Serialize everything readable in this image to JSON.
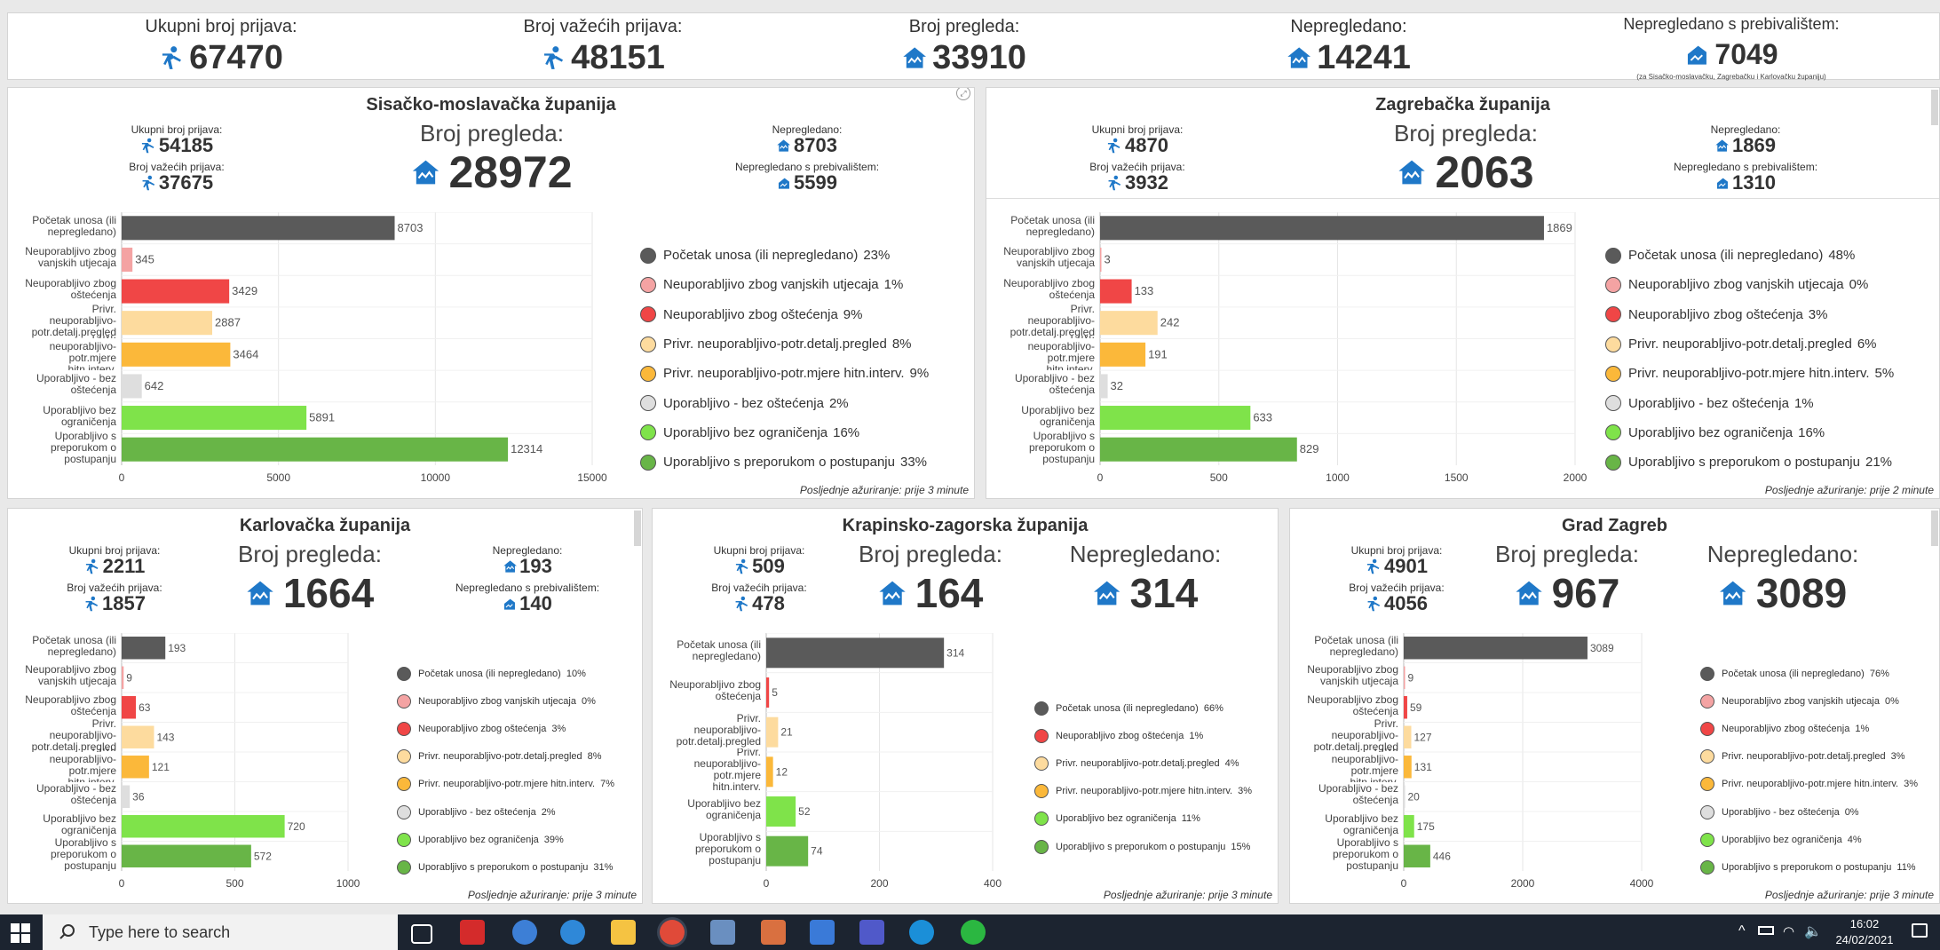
{
  "summary": [
    {
      "label": "Ukupni broj prijava:",
      "value": "67470",
      "icon": "person-icon"
    },
    {
      "label": "Broj važećih prijava:",
      "value": "48151",
      "icon": "person-icon"
    },
    {
      "label": "Broj pregleda:",
      "value": "33910",
      "icon": "house-icon"
    },
    {
      "label": "Nepregledano:",
      "value": "14241",
      "icon": "house-icon"
    },
    {
      "label": "Nepregledano s prebivalištem:",
      "value": "7049",
      "icon": "house-small-icon",
      "note": "(za Sisačko-moslavačku, Zagrebačku i Karlovačku županiju)"
    }
  ],
  "categories": [
    "Početak unosa (ili nepregledano)",
    "Neuporabljivo zbog vanjskih utjecaja",
    "Neuporabljivo zbog oštećenja",
    "Privr. neuporabljivo-potr.detalj.pregled",
    "Privr. neuporabljivo-potr.mjere hitn.interv.",
    "Uporabljivo - bez oštećenja",
    "Uporabljivo bez ograničenja",
    "Uporabljivo s preporukom o postupanju"
  ],
  "colors": {
    "Početak unosa (ili nepregledano)": "#5a5a5a",
    "Neuporabljivo zbog vanjskih utjecaja": "#f4a3a3",
    "Neuporabljivo zbog oštećenja": "#f04646",
    "Privr. neuporabljivo-potr.detalj.pregled": "#fddb9e",
    "Privr. neuporabljivo-potr.mjere hitn.interv.": "#fbb83a",
    "Uporabljivo - bez oštećenja": "#dedede",
    "Uporabljivo bez ograničenja": "#7fe34a",
    "Uporabljivo s preporukom o postupanju": "#68b547"
  },
  "labels": {
    "ukupni": "Ukupni broj prijava:",
    "vazecih": "Broj važećih prijava:",
    "pregleda": "Broj pregleda:",
    "nepregledano": "Nepregledano:",
    "prebivaliste": "Nepregledano s prebivalištem:"
  },
  "panels": [
    {
      "title": "Sisačko-moslavačka županija",
      "ukupni": "54185",
      "vazecih": "37675",
      "pregleda": "28972",
      "nepregledano": "8703",
      "prebivaliste": "5599",
      "footer": "Posljednje ažuriranje: prije 3 minute",
      "chart_data": {
        "type": "bar",
        "values": [
          8703,
          345,
          3429,
          2887,
          3464,
          642,
          5891,
          12314
        ],
        "xlim": [
          0,
          15000
        ],
        "ticks": [
          0,
          5000,
          10000,
          15000
        ]
      },
      "legend": [
        {
          "name": "Početak unosa (ili nepregledano)",
          "pct": "23%"
        },
        {
          "name": "Neuporabljivo zbog vanjskih utjecaja",
          "pct": "1%"
        },
        {
          "name": "Neuporabljivo zbog oštećenja",
          "pct": "9%"
        },
        {
          "name": "Privr. neuporabljivo-potr.detalj.pregled",
          "pct": "8%"
        },
        {
          "name": "Privr. neuporabljivo-potr.mjere hitn.interv.",
          "pct": "9%"
        },
        {
          "name": "Uporabljivo - bez oštećenja",
          "pct": "2%"
        },
        {
          "name": "Uporabljivo bez ograničenja",
          "pct": "16%"
        },
        {
          "name": "Uporabljivo s preporukom o postupanju",
          "pct": "33%"
        }
      ]
    },
    {
      "title": "Zagrebačka županija",
      "ukupni": "4870",
      "vazecih": "3932",
      "pregleda": "2063",
      "nepregledano": "1869",
      "prebivaliste": "1310",
      "footer": "Posljednje ažuriranje: prije 2 minute",
      "chart_data": {
        "type": "bar",
        "values": [
          1869,
          3,
          133,
          242,
          191,
          32,
          633,
          829
        ],
        "xlim": [
          0,
          2000
        ],
        "ticks": [
          0,
          500,
          1000,
          1500,
          2000
        ]
      },
      "legend": [
        {
          "name": "Početak unosa (ili nepregledano)",
          "pct": "48%"
        },
        {
          "name": "Neuporabljivo zbog vanjskih utjecaja",
          "pct": "0%"
        },
        {
          "name": "Neuporabljivo zbog oštećenja",
          "pct": "3%"
        },
        {
          "name": "Privr. neuporabljivo-potr.detalj.pregled",
          "pct": "6%"
        },
        {
          "name": "Privr. neuporabljivo-potr.mjere hitn.interv.",
          "pct": "5%"
        },
        {
          "name": "Uporabljivo - bez oštećenja",
          "pct": "1%"
        },
        {
          "name": "Uporabljivo bez ograničenja",
          "pct": "16%"
        },
        {
          "name": "Uporabljivo s preporukom o postupanju",
          "pct": "21%"
        }
      ]
    },
    {
      "title": "Karlovačka županija",
      "ukupni": "2211",
      "vazecih": "1857",
      "pregleda": "1664",
      "nepregledano": "193",
      "prebivaliste": "140",
      "footer": "Posljednje ažuriranje: prije 3 minute",
      "chart_data": {
        "type": "bar",
        "values": [
          193,
          9,
          63,
          143,
          121,
          36,
          720,
          572
        ],
        "xlim": [
          0,
          1000
        ],
        "ticks": [
          0,
          500,
          1000
        ]
      },
      "legend": [
        {
          "name": "Početak unosa (ili nepregledano)",
          "pct": "10%"
        },
        {
          "name": "Neuporabljivo zbog vanjskih utjecaja",
          "pct": "0%"
        },
        {
          "name": "Neuporabljivo zbog oštećenja",
          "pct": "3%"
        },
        {
          "name": "Privr. neuporabljivo-potr.detalj.pregled",
          "pct": "8%"
        },
        {
          "name": "Privr. neuporabljivo-potr.mjere hitn.interv.",
          "pct": "7%"
        },
        {
          "name": "Uporabljivo - bez oštećenja",
          "pct": "2%"
        },
        {
          "name": "Uporabljivo bez ograničenja",
          "pct": "39%"
        },
        {
          "name": "Uporabljivo s preporukom o postupanju",
          "pct": "31%"
        }
      ]
    },
    {
      "title": "Krapinsko-zagorska županija",
      "ukupni": "509",
      "vazecih": "478",
      "pregleda": "164",
      "nepregledano": "314",
      "footer": "Posljednje ažuriranje: prije 3 minute",
      "chart_data": {
        "type": "bar",
        "categories": [
          "Početak unosa (ili nepregledano)",
          "Neuporabljivo zbog oštećenja",
          "Privr. neuporabljivo-potr.detalj.pregled",
          "Privr. neuporabljivo-potr.mjere hitn.interv.",
          "Uporabljivo bez ograničenja",
          "Uporabljivo s preporukom o postupanju"
        ],
        "values": [
          314,
          5,
          21,
          12,
          52,
          74
        ],
        "xlim": [
          0,
          400
        ],
        "ticks": [
          0,
          200,
          400
        ]
      },
      "legend": [
        {
          "name": "Početak unosa (ili nepregledano)",
          "pct": "66%"
        },
        {
          "name": "Neuporabljivo zbog oštećenja",
          "pct": "1%"
        },
        {
          "name": "Privr. neuporabljivo-potr.detalj.pregled",
          "pct": "4%"
        },
        {
          "name": "Privr. neuporabljivo-potr.mjere hitn.interv.",
          "pct": "3%"
        },
        {
          "name": "Uporabljivo bez ograničenja",
          "pct": "11%"
        },
        {
          "name": "Uporabljivo s preporukom o postupanju",
          "pct": "15%"
        }
      ]
    },
    {
      "title": "Grad Zagreb",
      "ukupni": "4901",
      "vazecih": "4056",
      "pregleda": "967",
      "nepregledano": "3089",
      "footer": "Posljednje ažuriranje: prije 3 minute",
      "chart_data": {
        "type": "bar",
        "values": [
          3089,
          9,
          59,
          127,
          131,
          20,
          175,
          446
        ],
        "xlim": [
          0,
          4000
        ],
        "ticks": [
          0,
          2000,
          4000
        ]
      },
      "legend": [
        {
          "name": "Početak unosa (ili nepregledano)",
          "pct": "76%"
        },
        {
          "name": "Neuporabljivo zbog vanjskih utjecaja",
          "pct": "0%"
        },
        {
          "name": "Neuporabljivo zbog oštećenja",
          "pct": "1%"
        },
        {
          "name": "Privr. neuporabljivo-potr.detalj.pregled",
          "pct": "3%"
        },
        {
          "name": "Privr. neuporabljivo-potr.mjere hitn.interv.",
          "pct": "3%"
        },
        {
          "name": "Uporabljivo - bez oštećenja",
          "pct": "0%"
        },
        {
          "name": "Uporabljivo bez ograničenja",
          "pct": "4%"
        },
        {
          "name": "Uporabljivo s preporukom o postupanju",
          "pct": "11%"
        }
      ]
    }
  ],
  "taskbar": {
    "search_placeholder": "Type here to search",
    "time": "16:02",
    "date": "24/02/2021",
    "apps": [
      "task-view-icon",
      "acrobat-icon",
      "magnifier-app-icon",
      "network-app-icon",
      "file-explorer-icon",
      "chrome-icon",
      "calculator-icon",
      "paint-icon",
      "pen-app-icon",
      "teams-icon",
      "edge-icon",
      "whatsapp-icon"
    ]
  }
}
